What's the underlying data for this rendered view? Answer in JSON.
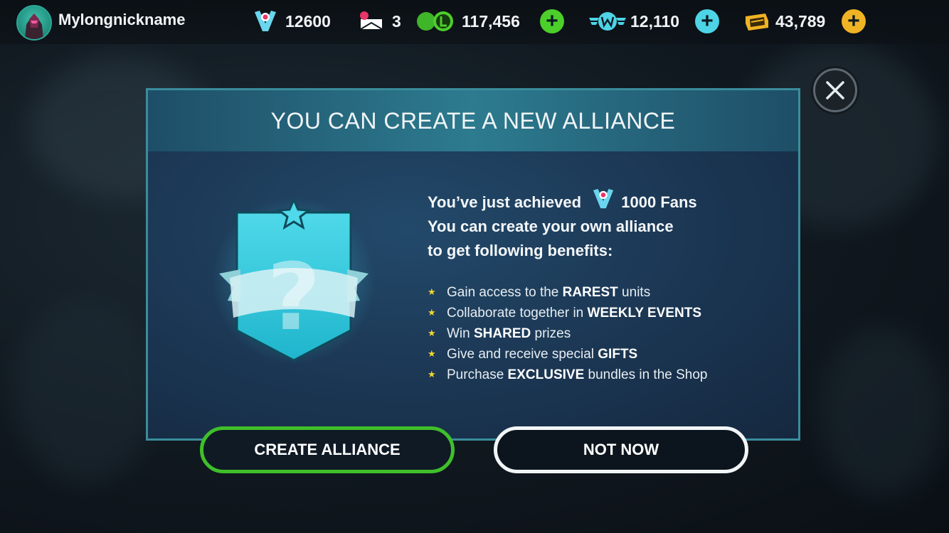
{
  "player": {
    "nickname": "Mylongnickname"
  },
  "currencies": {
    "fans": {
      "icon": "fans-icon",
      "value": "12600"
    },
    "mail": {
      "icon": "mail-icon",
      "value": "3"
    },
    "coins": {
      "icon": "coins-icon",
      "value": "117,456",
      "color": "#4ccf2a"
    },
    "wings": {
      "icon": "wings-icon",
      "value": "12,110",
      "color": "#4dd4e6"
    },
    "gold": {
      "icon": "gold-icon",
      "value": "43,789",
      "color": "#f0b324"
    }
  },
  "modal": {
    "title": "YOU CAN CREATE A NEW ALLIANCE",
    "intro_1": "You’ve just achieved",
    "intro_fans": "1000 Fans",
    "intro_2": "You can create your own alliance",
    "intro_3": "to get following benefits:",
    "benefits": [
      {
        "pre": "Gain access to the ",
        "bold": "RAREST",
        "post": " units"
      },
      {
        "pre": "Collaborate together in ",
        "bold": "WEEKLY EVENTS",
        "post": ""
      },
      {
        "pre": "Win ",
        "bold": "SHARED",
        "post": " prizes"
      },
      {
        "pre": "Give and receive special ",
        "bold": "GIFTS",
        "post": ""
      },
      {
        "pre": "Purchase ",
        "bold": "EXCLUSIVE",
        "post": " bundles in the Shop"
      }
    ],
    "badge_icon": "alliance-badge-icon",
    "create_label": "CREATE ALLIANCE",
    "not_now_label": "NOT NOW"
  },
  "colors": {
    "accent_green": "#3fbf2a",
    "accent_teal": "#3a8d9c",
    "star_yellow": "#f2d630"
  }
}
